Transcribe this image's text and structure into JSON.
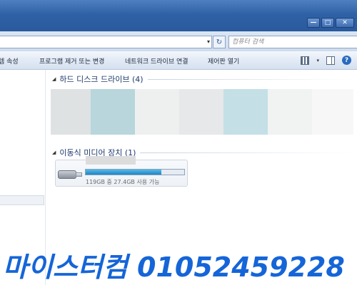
{
  "search": {
    "placeholder": "컴퓨터 검색"
  },
  "window_controls": {
    "minimize": "—",
    "maximize": "□",
    "close": "✕"
  },
  "address": {
    "dropdown": "▾",
    "refresh": "↻"
  },
  "toolbar": {
    "items": [
      {
        "label": "템 속성"
      },
      {
        "label": "프로그램 제거 또는 변경"
      },
      {
        "label": "네트워크 드라이브 연결"
      },
      {
        "label": "제어판 열기"
      }
    ],
    "help_label": "?"
  },
  "groups": {
    "hard_disks": {
      "title": "하드 디스크 드라이브 (4)",
      "toggle": "◢"
    },
    "removable": {
      "title": "이동식 미디어 장치 (1)",
      "toggle": "◢"
    }
  },
  "usb_drive": {
    "capacity_text": "119GB 중 27.4GB 사용 가능",
    "used_fraction": 0.77
  },
  "watermark": {
    "text": "마이스터컴 01052459228"
  },
  "colors": {
    "titlebar": "#2f61a6",
    "accent": "#1565d8",
    "usage_bar": "#1d86c4"
  },
  "drive_tiles": [
    "#dfe2e3",
    "#b8d6dc",
    "#eef0f0",
    "#e6e8e9",
    "#c4e0e6",
    "#f1f2f2",
    "#f7f7f7"
  ]
}
